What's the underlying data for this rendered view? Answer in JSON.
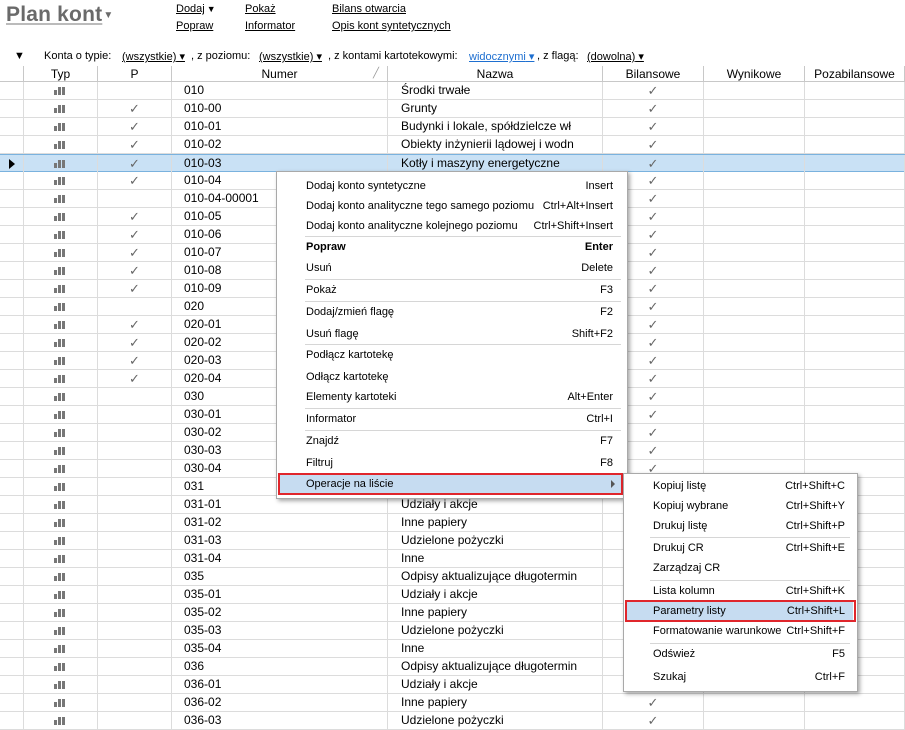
{
  "header": {
    "title": "Plan kont",
    "links": {
      "add": "Dodaj",
      "edit": "Popraw",
      "show": "Pokaż",
      "informer": "Informator",
      "opening_balance": "Bilans otwarcia",
      "synthetic_desc": "Opis kont syntetycznych"
    }
  },
  "filter": {
    "type_label": "Konta o typie:",
    "type_value": "(wszystkie)",
    "level_label": ", z poziomu:",
    "level_value": "(wszystkie)",
    "card_label": ", z kontami kartotekowymi:",
    "card_value": "widocznymi",
    "flag_label": ", z flagą:",
    "flag_value": "(dowolna)"
  },
  "columns": {
    "typ": "Typ",
    "p": "P",
    "numer": "Numer",
    "nazwa": "Nazwa",
    "bilansowe": "Bilansowe",
    "wynikowe": "Wynikowe",
    "pozabilansowe": "Pozabilansowe"
  },
  "check_glyph": "✓",
  "rows": [
    {
      "numer": "010",
      "nazwa": "Środki trwałe",
      "p": false,
      "bil": true
    },
    {
      "numer": "010-00",
      "nazwa": "Grunty",
      "p": true,
      "bil": true
    },
    {
      "numer": "010-01",
      "nazwa": "Budynki i lokale, spółdzielcze wł",
      "p": true,
      "bil": true
    },
    {
      "numer": "010-02",
      "nazwa": "Obiekty inżynierii lądowej i wodn",
      "p": true,
      "bil": true
    },
    {
      "numer": "010-03",
      "nazwa": "Kotły i maszyny energetyczne",
      "p": true,
      "bil": true,
      "selected": true
    },
    {
      "numer": "010-04",
      "nazwa": "",
      "p": true,
      "bil": true
    },
    {
      "numer": "010-04-00001",
      "nazwa": "",
      "p": false,
      "bil": true
    },
    {
      "numer": "010-05",
      "nazwa": "",
      "p": true,
      "bil": true
    },
    {
      "numer": "010-06",
      "nazwa": "",
      "p": true,
      "bil": true
    },
    {
      "numer": "010-07",
      "nazwa": "",
      "p": true,
      "bil": true
    },
    {
      "numer": "010-08",
      "nazwa": "",
      "p": true,
      "bil": true
    },
    {
      "numer": "010-09",
      "nazwa": "",
      "p": true,
      "bil": true
    },
    {
      "numer": "020",
      "nazwa": "",
      "p": false,
      "bil": true
    },
    {
      "numer": "020-01",
      "nazwa": "",
      "p": true,
      "bil": true
    },
    {
      "numer": "020-02",
      "nazwa": "",
      "p": true,
      "bil": true
    },
    {
      "numer": "020-03",
      "nazwa": "",
      "p": true,
      "bil": true
    },
    {
      "numer": "020-04",
      "nazwa": "",
      "p": true,
      "bil": true
    },
    {
      "numer": "030",
      "nazwa": "",
      "p": false,
      "bil": true
    },
    {
      "numer": "030-01",
      "nazwa": "",
      "p": false,
      "bil": true
    },
    {
      "numer": "030-02",
      "nazwa": "",
      "p": false,
      "bil": true
    },
    {
      "numer": "030-03",
      "nazwa": "",
      "p": false,
      "bil": true
    },
    {
      "numer": "030-04",
      "nazwa": "",
      "p": false,
      "bil": true
    },
    {
      "numer": "031",
      "nazwa": "",
      "p": false,
      "bil": false
    },
    {
      "numer": "031-01",
      "nazwa": "Udziały i akcje",
      "p": false,
      "bil": false
    },
    {
      "numer": "031-02",
      "nazwa": "Inne papiery",
      "p": false,
      "bil": false
    },
    {
      "numer": "031-03",
      "nazwa": "Udzielone pożyczki",
      "p": false,
      "bil": false
    },
    {
      "numer": "031-04",
      "nazwa": "Inne",
      "p": false,
      "bil": false
    },
    {
      "numer": "035",
      "nazwa": "Odpisy aktualizujące długotermin",
      "p": false,
      "bil": false
    },
    {
      "numer": "035-01",
      "nazwa": "Udziały i akcje",
      "p": false,
      "bil": false
    },
    {
      "numer": "035-02",
      "nazwa": "Inne papiery",
      "p": false,
      "bil": false
    },
    {
      "numer": "035-03",
      "nazwa": "Udzielone pożyczki",
      "p": false,
      "bil": false
    },
    {
      "numer": "035-04",
      "nazwa": "Inne",
      "p": false,
      "bil": false
    },
    {
      "numer": "036",
      "nazwa": "Odpisy aktualizujące długotermin",
      "p": false,
      "bil": false
    },
    {
      "numer": "036-01",
      "nazwa": "Udziały i akcje",
      "p": false,
      "bil": false
    },
    {
      "numer": "036-02",
      "nazwa": "Inne papiery",
      "p": false,
      "bil": true
    },
    {
      "numer": "036-03",
      "nazwa": "Udzielone pożyczki",
      "p": false,
      "bil": true
    }
  ],
  "context_menu": [
    {
      "label": "Dodaj konto syntetyczne",
      "shortcut": "Insert"
    },
    {
      "label": "Dodaj konto analityczne tego samego poziomu",
      "shortcut": "Ctrl+Alt+Insert"
    },
    {
      "label": "Dodaj konto analityczne kolejnego poziomu",
      "shortcut": "Ctrl+Shift+Insert"
    },
    {
      "label": "Popraw",
      "shortcut": "Enter",
      "bold": true
    },
    {
      "label": "Usuń",
      "shortcut": "Delete"
    },
    {
      "label": "Pokaż",
      "shortcut": "F3"
    },
    {
      "label": "Dodaj/zmień flagę",
      "shortcut": "F2"
    },
    {
      "label": "Usuń flagę",
      "shortcut": "Shift+F2"
    },
    {
      "label": "Podłącz kartotekę",
      "shortcut": ""
    },
    {
      "label": "Odłącz kartotekę",
      "shortcut": ""
    },
    {
      "label": "Elementy kartoteki",
      "shortcut": "Alt+Enter"
    },
    {
      "label": "Informator",
      "shortcut": "Ctrl+I"
    },
    {
      "label": "Znajdź",
      "shortcut": "F7"
    },
    {
      "label": "Filtruj",
      "shortcut": "F8"
    },
    {
      "label": "Operacje na liście",
      "shortcut": "",
      "submenu": true,
      "highlighted": true
    }
  ],
  "submenu": [
    {
      "label": "Kopiuj listę",
      "shortcut": "Ctrl+Shift+C"
    },
    {
      "label": "Kopiuj wybrane",
      "shortcut": "Ctrl+Shift+Y"
    },
    {
      "label": "Drukuj listę",
      "shortcut": "Ctrl+Shift+P"
    },
    {
      "label": "Drukuj CR",
      "shortcut": "Ctrl+Shift+E"
    },
    {
      "label": "Zarządzaj CR",
      "shortcut": ""
    },
    {
      "label": "Lista kolumn",
      "shortcut": "Ctrl+Shift+K"
    },
    {
      "label": "Parametry listy",
      "shortcut": "Ctrl+Shift+L",
      "highlighted": true
    },
    {
      "label": "Formatowanie warunkowe",
      "shortcut": "Ctrl+Shift+F"
    },
    {
      "label": "Odśwież",
      "shortcut": "F5"
    },
    {
      "label": "Szukaj",
      "shortcut": "Ctrl+F"
    }
  ]
}
